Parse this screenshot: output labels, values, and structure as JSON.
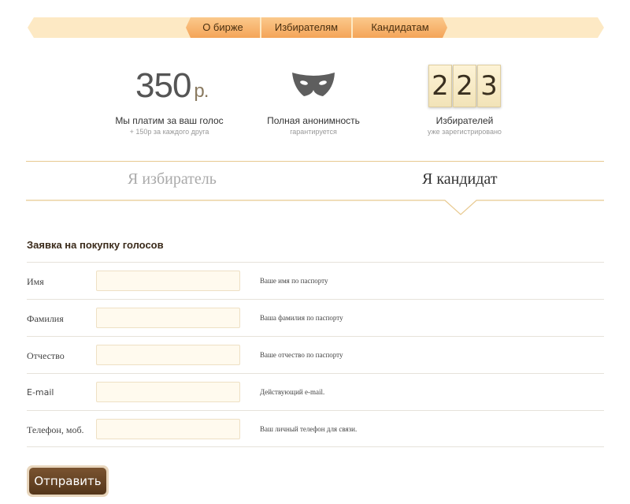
{
  "nav": {
    "items": [
      "О бирже",
      "Избирателям",
      "Кандидатам"
    ]
  },
  "stats": {
    "price": {
      "value": "350",
      "unit": "р.",
      "label": "Мы платим за ваш голос",
      "sub": "+ 150р за каждого друга"
    },
    "anon": {
      "icon": "mask-icon",
      "label": "Полная анонимность",
      "sub": "гарантируется"
    },
    "voters": {
      "digits": [
        "2",
        "2",
        "3"
      ],
      "label": "Избирателей",
      "sub": "уже зарегистрировано"
    }
  },
  "roles": {
    "voter": "Я избиратель",
    "candidate": "Я кандидат",
    "active": "candidate"
  },
  "form": {
    "title": "Заявка на покупку голосов",
    "fields": [
      {
        "label": "Имя",
        "value": "",
        "hint": "Ваше имя по паспорту"
      },
      {
        "label": "Фамилия",
        "value": "",
        "hint": "Ваша фамилия по паспорту"
      },
      {
        "label": "Отчество",
        "value": "",
        "hint": "Ваше отчество по паспорту"
      },
      {
        "label": "E-mail",
        "value": "",
        "hint": "Действующий e-mail."
      },
      {
        "label": "Телефон, моб.",
        "value": "",
        "hint": "Ваш личный телефон для связи."
      }
    ],
    "submit": "Отправить"
  }
}
